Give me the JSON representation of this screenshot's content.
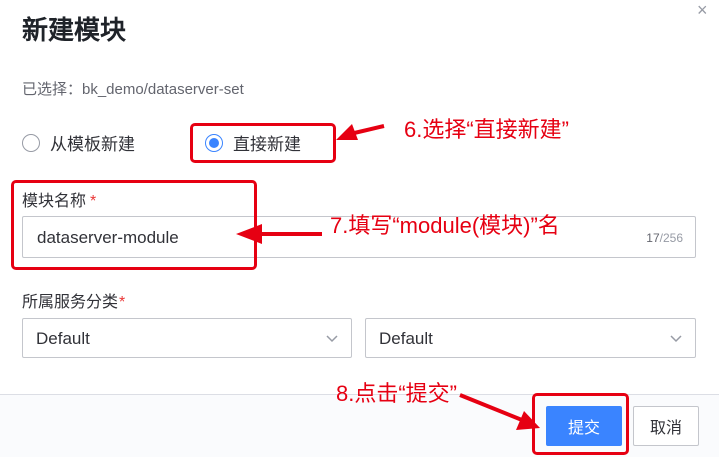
{
  "dialog": {
    "title": "新建模块",
    "close_glyph": "×",
    "selected_path": "已选择：bk_demo/dataserver-set"
  },
  "creation_mode": {
    "options": [
      {
        "label": "从模板新建",
        "checked": false
      },
      {
        "label": "直接新建",
        "checked": true
      }
    ]
  },
  "module_name": {
    "label": "模块名称",
    "required_mark": "*",
    "value": "dataserver-module",
    "count_current": "17",
    "count_max": "/256"
  },
  "service_category": {
    "label": "所属服务分类",
    "required_mark": "*",
    "primary_value": "Default",
    "secondary_value": "Default"
  },
  "footer": {
    "submit_label": "提交",
    "cancel_label": "取消"
  },
  "annotations": {
    "step6": "6.选择“直接新建”",
    "step7": "7.填写“module(模块)”名",
    "step8": "8.点击“提交”"
  },
  "colors": {
    "accent": "#3a84ff",
    "annotation_red": "#e60012",
    "required_red": "#ea3636"
  },
  "icons": [
    "close-icon",
    "radio-icon",
    "chevron-down-icon",
    "arrow-icon"
  ]
}
